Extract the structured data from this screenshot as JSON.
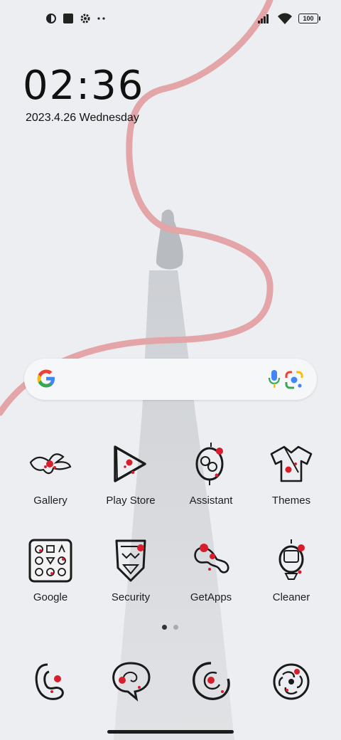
{
  "status_bar": {
    "left_icons": [
      "circle-half-icon",
      "square-icon",
      "gear-icon",
      "more-icon"
    ],
    "right_icons": [
      "signal-icon",
      "wifi-icon"
    ],
    "battery": "100"
  },
  "clock": {
    "time": "02:36",
    "date": "2023.4.26 Wednesday"
  },
  "search": {
    "icons": [
      "google-g-icon",
      "mic-icon",
      "lens-icon"
    ]
  },
  "apps": [
    {
      "label": "Gallery"
    },
    {
      "label": "Play Store"
    },
    {
      "label": "Assistant"
    },
    {
      "label": "Themes"
    },
    {
      "label": "Google"
    },
    {
      "label": "Security"
    },
    {
      "label": "GetApps"
    },
    {
      "label": "Cleaner"
    }
  ],
  "page_indicator": {
    "pages": 2,
    "active": 0
  },
  "dock": [
    {
      "icon": "phone-dock-icon"
    },
    {
      "icon": "messages-dock-icon"
    },
    {
      "icon": "browser-dock-icon"
    },
    {
      "icon": "camera-dock-icon"
    }
  ],
  "colors": {
    "background": "#eceef1",
    "ribbon": "#e3a5a8",
    "accent_red": "#d81e2a",
    "ink": "#1a1a1a"
  }
}
